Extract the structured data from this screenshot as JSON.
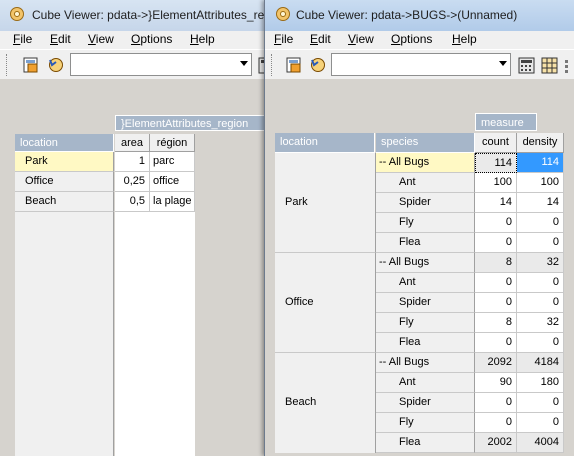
{
  "win1": {
    "title": "Cube Viewer: pdata->}ElementAttributes_re",
    "menu": [
      "File",
      "Edit",
      "View",
      "Options",
      "Help"
    ],
    "title_dim": "}ElementAttributes_region",
    "row_dim": "location",
    "columns": [
      "area",
      "région"
    ],
    "rows": [
      {
        "label": "Park",
        "area": "1",
        "region": "parc"
      },
      {
        "label": "Office",
        "area": "0,25",
        "region": "office"
      },
      {
        "label": "Beach",
        "area": "0,5",
        "region": "la plage"
      }
    ]
  },
  "win2": {
    "title": "Cube Viewer: pdata->BUGS->(Unnamed)",
    "menu": [
      "File",
      "Edit",
      "View",
      "Options",
      "Help"
    ],
    "col_dim": "measure",
    "row_dims": [
      "location",
      "species"
    ],
    "columns": [
      "count",
      "density"
    ],
    "groups": [
      {
        "location": "Park",
        "rows": [
          {
            "species": "-- All Bugs",
            "count": "114",
            "density": "114"
          },
          {
            "species": "Ant",
            "count": "100",
            "density": "100"
          },
          {
            "species": "Spider",
            "count": "14",
            "density": "14"
          },
          {
            "species": "Fly",
            "count": "0",
            "density": "0"
          },
          {
            "species": "Flea",
            "count": "0",
            "density": "0"
          }
        ]
      },
      {
        "location": "Office",
        "rows": [
          {
            "species": "-- All Bugs",
            "count": "8",
            "density": "32"
          },
          {
            "species": "Ant",
            "count": "0",
            "density": "0"
          },
          {
            "species": "Spider",
            "count": "0",
            "density": "0"
          },
          {
            "species": "Fly",
            "count": "8",
            "density": "32"
          },
          {
            "species": "Flea",
            "count": "0",
            "density": "0"
          }
        ]
      },
      {
        "location": "Beach",
        "rows": [
          {
            "species": "-- All Bugs",
            "count": "2092",
            "density": "4184"
          },
          {
            "species": "Ant",
            "count": "90",
            "density": "180"
          },
          {
            "species": "Spider",
            "count": "0",
            "density": "0"
          },
          {
            "species": "Fly",
            "count": "0",
            "density": "0"
          },
          {
            "species": "Flea",
            "count": "2002",
            "density": "4004"
          }
        ]
      }
    ]
  },
  "icons": {
    "app": "cube-icon",
    "toolbar": [
      "recalc-icon",
      "rollback-icon",
      "calculator-icon",
      "grid-icon"
    ]
  },
  "colors": {
    "header": "#a6b6c9",
    "selected_row": "#fff9c4",
    "highlight": "#3399ff"
  }
}
